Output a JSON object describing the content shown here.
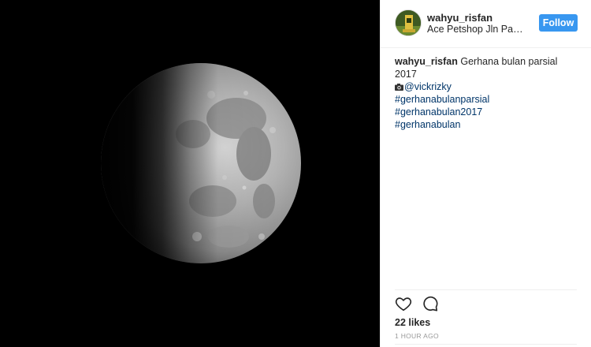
{
  "post": {
    "photo_subject": "partial lunar eclipse"
  },
  "header": {
    "username": "wahyu_risfan",
    "location": "Ace Petshop Jln Panj…",
    "follow_label": "Follow"
  },
  "caption": {
    "username": "wahyu_risfan",
    "text": "Gerhana bulan parsial 2017",
    "camera_emoji": "camera-icon",
    "mention": "@vickrizky",
    "hashtags_line1": "#gerhanabulanparsial #gerhanabulan2017",
    "hashtags_line2": "#gerhanabulan"
  },
  "actions": {
    "like_icon": "heart-icon",
    "comment_icon": "comment-icon"
  },
  "likes": "22 likes",
  "timestamp": "1 HOUR AGO",
  "colors": {
    "follow_button": "#3897f0",
    "link": "#003569",
    "timestamp": "#999999",
    "photo_bg": "#000000"
  }
}
